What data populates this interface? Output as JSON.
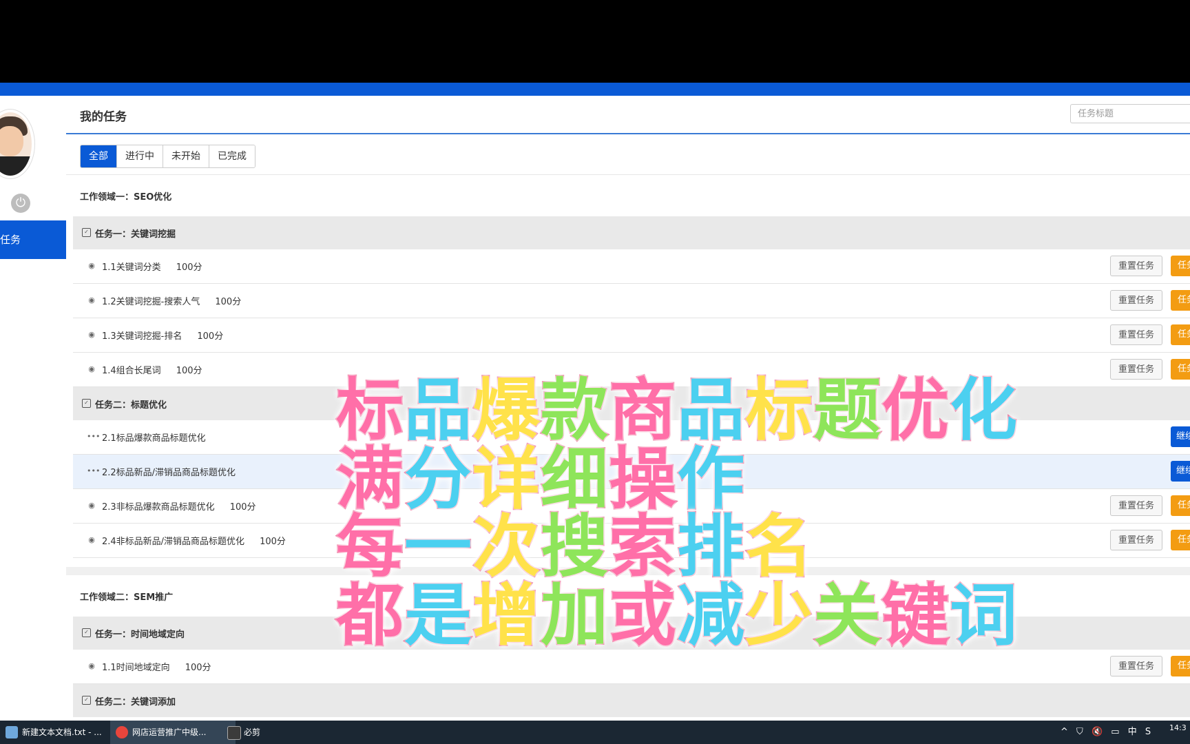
{
  "app": {
    "header_title": "我的任务",
    "search_placeholder": "任务标题",
    "nav_active_label": "任务"
  },
  "tabs": [
    {
      "label": "全部",
      "active": true
    },
    {
      "label": "进行中",
      "active": false
    },
    {
      "label": "未开始",
      "active": false
    },
    {
      "label": "已完成",
      "active": false
    }
  ],
  "domains": [
    {
      "label": "工作领域一：SEO优化",
      "groups": [
        {
          "label": "任务一：关键词挖掘",
          "items": [
            {
              "title": "1.1关键词分类",
              "score": "100分",
              "icon": "eye-icon",
              "reset": "重置任务",
              "action": "任务"
            },
            {
              "title": "1.2关键词挖掘-搜索人气",
              "score": "100分",
              "icon": "eye-icon",
              "reset": "重置任务",
              "action": "任务"
            },
            {
              "title": "1.3关键词挖掘-排名",
              "score": "100分",
              "icon": "eye-icon",
              "reset": "重置任务",
              "action": "任务"
            },
            {
              "title": "1.4组合长尾词",
              "score": "100分",
              "icon": "eye-icon",
              "reset": "重置任务",
              "action": "任务"
            }
          ]
        },
        {
          "label": "任务二：标题优化",
          "items": [
            {
              "title": "2.1标品爆款商品标题优化",
              "score": "",
              "icon": "more-dots-icon",
              "action": "继续"
            },
            {
              "title": "2.2标品新品/滞销品商品标题优化",
              "score": "",
              "icon": "more-dots-icon",
              "action": "继续"
            },
            {
              "title": "2.3非标品爆款商品标题优化",
              "score": "100分",
              "icon": "eye-icon",
              "reset": "重置任务",
              "action": "任务"
            },
            {
              "title": "2.4非标品新品/滞销品商品标题优化",
              "score": "100分",
              "icon": "eye-icon",
              "reset": "重置任务",
              "action": "任务"
            }
          ]
        }
      ]
    },
    {
      "label": "工作领域二：SEM推广",
      "groups": [
        {
          "label": "任务一：时间地域定向",
          "items": [
            {
              "title": "1.1时间地域定向",
              "score": "100分",
              "icon": "eye-icon",
              "reset": "重置任务",
              "action": "任务"
            }
          ]
        },
        {
          "label": "任务二：关键词添加",
          "items": []
        }
      ]
    }
  ],
  "overlay_lines": [
    "标品爆款商品标题优化",
    "满分详细操作",
    "每一次搜索排名",
    "都是增加或减少关键词"
  ],
  "taskbar": {
    "items": [
      "新建文本文档.txt - ...",
      "网店运营推广中级...",
      "必剪"
    ],
    "tray": [
      "^",
      "中"
    ],
    "clock_time": "14:3"
  }
}
